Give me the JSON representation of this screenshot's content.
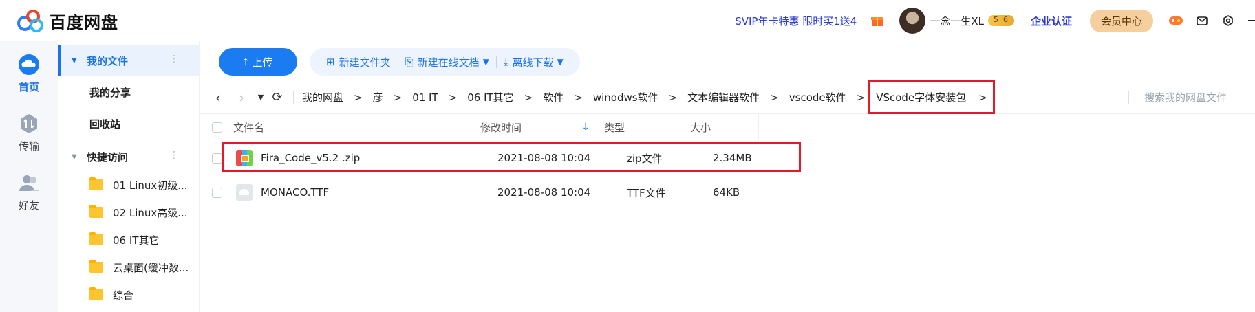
{
  "header": {
    "app_title": "百度网盘",
    "promo": "SVIP年卡特惠 限时买1送4",
    "username": "一念一生XL",
    "enterprise": "企业认证",
    "member_center": "会员中心",
    "icons": [
      "gift-icon",
      "game-icon",
      "mail-icon",
      "settings-icon"
    ]
  },
  "leftnav": {
    "items": [
      {
        "label": "首页",
        "icon": "cloud-icon",
        "active": true
      },
      {
        "label": "传输",
        "icon": "transfer-icon",
        "active": false
      },
      {
        "label": "好友",
        "icon": "friends-icon",
        "active": false
      }
    ]
  },
  "sidebar": {
    "my_files": "我的文件",
    "my_share": "我的分享",
    "recycle": "回收站",
    "quick_access": "快捷访问",
    "folders": [
      "01 Linux初级...",
      "02 Linux高级...",
      "06 IT其它",
      "云桌面(缓冲数...",
      "综合"
    ]
  },
  "toolbar": {
    "upload": "上传",
    "new_folder": "新建文件夹",
    "new_doc": "新建在线文档",
    "offline_download": "离线下载"
  },
  "breadcrumb": {
    "items": [
      "我的网盘",
      "彦",
      "01 IT",
      "06 IT其它",
      "软件",
      "winodws软件",
      "文本编辑器软件",
      "vscode软件"
    ],
    "current": "VScode字体安装包",
    "search_placeholder": "搜索我的网盘文件"
  },
  "table": {
    "headers": {
      "name": "文件名",
      "modified": "修改时间",
      "type": "类型",
      "size": "大小"
    },
    "rows": [
      {
        "name": "Fira_Code_v5.2 .zip",
        "modified": "2021-08-08 10:04",
        "type": "zip文件",
        "size": "2.34MB",
        "icon": "zip-icon"
      },
      {
        "name": "MONACO.TTF",
        "modified": "2021-08-08 10:04",
        "type": "TTF文件",
        "size": "64KB",
        "icon": "font-file-icon"
      }
    ]
  },
  "colors": {
    "accent": "#1a7cf0",
    "highlight": "#e6192b",
    "promo": "#2a3ad8"
  }
}
